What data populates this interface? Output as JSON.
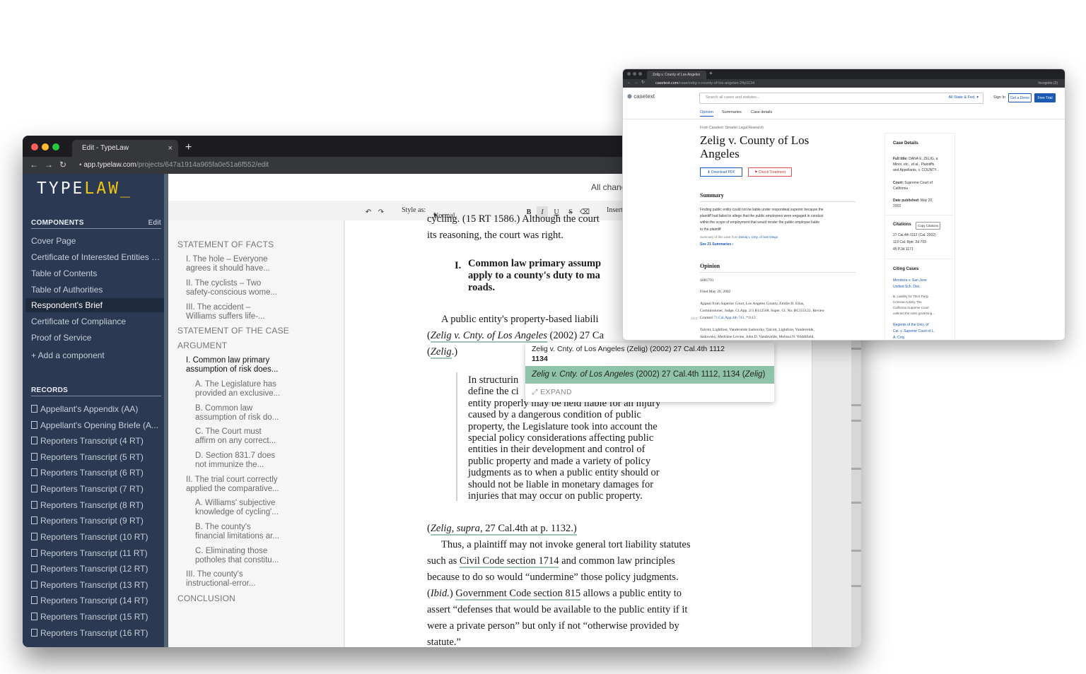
{
  "typelaw": {
    "tab_title": "Edit - TypeLaw",
    "tab_close": "×",
    "new_tab": "+",
    "url_domain": "app.typelaw.com",
    "url_path": "/projects/647a1914a965fa0e51a6f552/edit",
    "logo_main": "TYPE",
    "logo_accent": "LAW",
    "logo_cursor": "_",
    "status": "All chang",
    "components_header": "COMPONENTS",
    "edit_label": "Edit",
    "components": [
      "Cover Page",
      "Certificate of Interested Entities o...",
      "Table of Contents",
      "Table of Authorities",
      "Respondent's Brief",
      "Certificate of Compliance",
      "Proof of Service"
    ],
    "add_component": "+ Add a component",
    "records_header": "RECORDS",
    "records": [
      "Appellant's Appendix (AA)",
      "Appellant's Opening Briefe (A...",
      "Reporters Transcript (4 RT)",
      "Reporters Transcript (5 RT)",
      "Reporters Transcript (6 RT)",
      "Reporters Transcript (7 RT)",
      "Reporters Transcript (8 RT)",
      "Reporters Transcript (9 RT)",
      "Reporters Transcript (10 RT)",
      "Reporters Transcript (11 RT)",
      "Reporters Transcript (12 RT)",
      "Reporters Transcript (13 RT)",
      "Reporters Transcript (14 RT)",
      "Reporters Transcript (15 RT)",
      "Reporters Transcript (16 RT)"
    ],
    "toolbar": {
      "undo": "↶",
      "redo": "↷",
      "style_label": "Style as:",
      "style_value": "Normal Paragraph Text",
      "bold": "B",
      "italic": "I",
      "underline": "U",
      "strike": "S",
      "eraser": "⌫",
      "insert": "Insert"
    },
    "outline": [
      {
        "text": "STATEMENT OF FACTS"
      },
      {
        "text": "I. The hole – Everyone"
      },
      {
        "text": "agrees it should have..."
      },
      {
        "text": "II. The cyclists – Two"
      },
      {
        "text": "safety-conscious wome..."
      },
      {
        "text": "III. The accident –"
      },
      {
        "text": "Williams suffers life-..."
      },
      {
        "text": "STATEMENT OF THE CASE"
      },
      {
        "text": "ARGUMENT"
      },
      {
        "text": "I. Common law primary"
      },
      {
        "text": "assumption of risk does..."
      },
      {
        "text": "A. The Legislature has"
      },
      {
        "text": "provided an exclusive..."
      },
      {
        "text": "B. Common law"
      },
      {
        "text": "assumption of risk do..."
      },
      {
        "text": "C. The Court must"
      },
      {
        "text": "affirm on any correct..."
      },
      {
        "text": "D. Section 831.7 does"
      },
      {
        "text": "not immunize the..."
      },
      {
        "text": "II. The trial court correctly"
      },
      {
        "text": "applied the comparative..."
      },
      {
        "text": "A. Williams' subjective"
      },
      {
        "text": "knowledge of cycling'..."
      },
      {
        "text": "B. The county's"
      },
      {
        "text": "financial limitations ar..."
      },
      {
        "text": "C. Eliminating those"
      },
      {
        "text": "potholes that constitu..."
      },
      {
        "text": "III. The county's"
      },
      {
        "text": "instructional-error..."
      },
      {
        "text": "CONCLUSION"
      }
    ],
    "doc": {
      "l0": "cycling. (15 RT 1586.) Although the court",
      "l1": "its reasoning, the court was right.",
      "h_num": "I.",
      "h1": "Common law primary assump",
      "h2": "apply to a county's duty to ma",
      "h3": "roads.",
      "p1": "A public entity's property-based liabili",
      "p2_a": "(",
      "p2_b": "Zelig v. Cnty. of Los Angeles",
      "p2_c": " (2002) 27 Ca",
      "p3_a": "(",
      "p3_b": "Zelig",
      "p3_c": ".)",
      "q1": "In structurin",
      "q2": "define the ci",
      "q3": "entity properly may be held liable for an injury",
      "q4": "caused by a dangerous condition of public",
      "q5": "property, the Legislature took into account the",
      "q6": "special policy considerations affecting public",
      "q7": "entities in their development and control of",
      "q8": "public property and made a variety of policy",
      "q9": "judgments as to when a public entity should or",
      "q10": "should not be liable in monetary damages for",
      "q11": "injuries that may occur on public property.",
      "s1_a": "(",
      "s1_b": "Zelig, supra",
      "s1_c": ", 27 Cal.4th at p. 1132.)",
      "b1": "Thus, a plaintiff may not invoke general tort liability statutes",
      "b2_a": "such as ",
      "b2_b": "Civil Code section 1714",
      "b2_c": " and common law principles",
      "b3": "because to do so would “undermine” those policy judgments.",
      "b4_a": "(",
      "b4_b": "Ibid.",
      "b4_c": ") ",
      "b4_d": "Government Code section 815",
      "b4_e": " allows a public entity to",
      "b5": "assert “defenses that would be available to the public entity if it",
      "b6": "were a private person” but only if not “otherwise provided by",
      "b7": "statute.”"
    },
    "popup": {
      "raw": "Zelig v. Cnty. of Los Angeles (Zelig) (2002) 27 Cal.4th 1112",
      "raw_page": "1134",
      "suggest_name": "Zelig v. Cnty. of Los Angeles",
      "suggest_rest": " (2002) 27 Cal.4th 1112, 1134 (",
      "suggest_short": "Zelig",
      "suggest_close": ")",
      "expand": "EXPAND"
    }
  },
  "casetext": {
    "tab_title": "Zelig v. County of Los Angeles",
    "url_domain": "casetext.com",
    "url_path": "/case/zelig-v-county-of-los-angeles-24p1134",
    "incognito": "Incognito (3)",
    "brand": "casetext",
    "search_placeholder": "Search all cases and statutes...",
    "jurisdiction": "All State & Fed.",
    "sign_in": "Sign In",
    "get_demo": "Get a Demo",
    "free_trial": "Free Trial",
    "tabs": [
      "Opinion",
      "Summaries",
      "Case details"
    ],
    "from": "From Casetext: Smarter Legal Research",
    "title1": "Zelig v. County of Los",
    "title2": "Angeles",
    "download": "Download PDF",
    "check": "Check Treatment",
    "summary_h": "Summary",
    "summary_1": "Finding public entity could not be liable under respondeat superior because the",
    "summary_2": "plaintiff had failed to allege that the public employees were engaged in conduct",
    "summary_3": "within the scope of employment that would render the public employee liable",
    "summary_4": "to the plaintiff",
    "summary_from_a": "Summary of this case from ",
    "summary_from_b": "Darraj v. Cnty. of San Diego",
    "see_summaries": "See 21 Summaries ›",
    "opinion_h": "Opinion",
    "docket": "S081791",
    "filed": "Filed May 20, 2002",
    "appeal_1": "Appeal from Superior Court, Los Angeles County, Emilie H. Elias,",
    "appeal_2": "Commissioner, Judge, Ct.App. 2/3 B112568, Super. Ct. No. BC155122. Review",
    "appeal_3_a": "Granted ",
    "appeal_3_b": "73 Cal.App.4th 741",
    "appeal_3_c": ". *1113",
    "margin_num": "1113",
    "counsel_1": "Talcott, Lightfoot, Vandevelde Sadowsky, Talcott, Lightfoot, Vandevelde,",
    "counsel_2": "Sadowsky, Medvene Levine, John D. Vandevelde, Melissa N. Widdifield,",
    "details_h": "Case Details",
    "full_title_l": "Full title:",
    "full_title_1": " DANA E. ZELIG, a",
    "full_title_2": "Minor, etc., et al., Plaintiffs",
    "full_title_3": "and Appellants, v. COUNTY...",
    "court_l": "Court:",
    "court_1": " Supreme Court of",
    "court_2": "California",
    "date_l": "Date published:",
    "date_1": " May 20,",
    "date_2": "2002",
    "citations_h": "Citations",
    "copy_citations": "Copy Citations",
    "cit1": "27 Cal.4th 1112 (Cal. 2002)",
    "cit2": "119 Cal. Rptr. 2d 709",
    "cit3": "45 P.3d 1171",
    "citing_h": "Citing Cases",
    "cc1_1": "Mendoza v. San Jose",
    "cc1_2": "Unified Sch. Dist.",
    "cc1_d1": "B. Liability for Third Party",
    "cc1_d2": "Criminal Activity The",
    "cc1_d3": "California Supreme Court",
    "cc1_d4": "outlined the rules governing...",
    "cc2_1": "Regents of the Univ. of",
    "cc2_2": "Cal. v. Superior Court of L.",
    "cc2_3": "A. Cnty."
  }
}
